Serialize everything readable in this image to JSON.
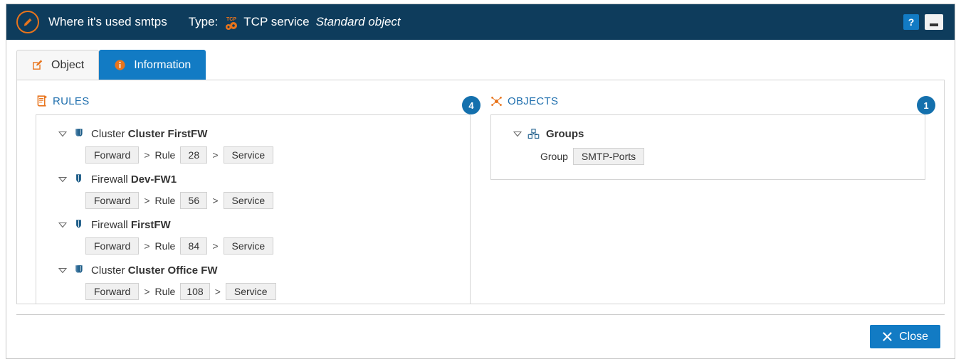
{
  "window": {
    "logo_icon": "pencil-circle-icon",
    "title": "Where it's used smtps",
    "type_label": "Type:",
    "type_icon": "tcp-gears-icon",
    "type_value": "TCP service",
    "object_kind": "Standard object",
    "help_label": "?",
    "help_icon": "help-icon",
    "minimize_icon": "minimize-icon"
  },
  "tabs": [
    {
      "label": "Object",
      "icon": "edit-pencil-icon",
      "active": false
    },
    {
      "label": "Information",
      "icon": "info-circle-icon",
      "active": true
    }
  ],
  "rules_section": {
    "icon": "scroll-document-icon",
    "title": "RULES",
    "badge": "4",
    "nodes": [
      {
        "caret_icon": "caret-down-icon",
        "icon": "cluster-shields-icon",
        "prefix": "Cluster",
        "name": "Cluster FirstFW",
        "crumb": {
          "action": "Forward",
          "sep1": ">",
          "rule_label": "Rule",
          "rule_number": "28",
          "sep2": ">",
          "target": "Service"
        }
      },
      {
        "caret_icon": "caret-down-icon",
        "icon": "firewall-shield-icon",
        "prefix": "Firewall",
        "name": "Dev-FW1",
        "crumb": {
          "action": "Forward",
          "sep1": ">",
          "rule_label": "Rule",
          "rule_number": "56",
          "sep2": ">",
          "target": "Service"
        }
      },
      {
        "caret_icon": "caret-down-icon",
        "icon": "firewall-shield-icon",
        "prefix": "Firewall",
        "name": "FirstFW",
        "crumb": {
          "action": "Forward",
          "sep1": ">",
          "rule_label": "Rule",
          "rule_number": "84",
          "sep2": ">",
          "target": "Service"
        }
      },
      {
        "caret_icon": "caret-down-icon",
        "icon": "cluster-shields-icon",
        "prefix": "Cluster",
        "name": "Cluster Office FW",
        "crumb": {
          "action": "Forward",
          "sep1": ">",
          "rule_label": "Rule",
          "rule_number": "108",
          "sep2": ">",
          "target": "Service"
        }
      }
    ]
  },
  "objects_section": {
    "icon": "objects-hub-icon",
    "title": "OBJECTS",
    "badge": "1",
    "node": {
      "caret_icon": "caret-down-icon",
      "icon": "group-cubes-icon",
      "name": "Groups",
      "item_label": "Group",
      "item_value": "SMTP-Ports"
    }
  },
  "footer": {
    "close_label": "Close",
    "close_icon": "close-x-icon"
  },
  "colors": {
    "titlebar_bg": "#0e3c5c",
    "accent_orange": "#e8741c",
    "accent_blue": "#127bc4",
    "badge_blue": "#1470ad",
    "section_title_blue": "#1f6fae",
    "shield_blue": "#1c5c87"
  }
}
